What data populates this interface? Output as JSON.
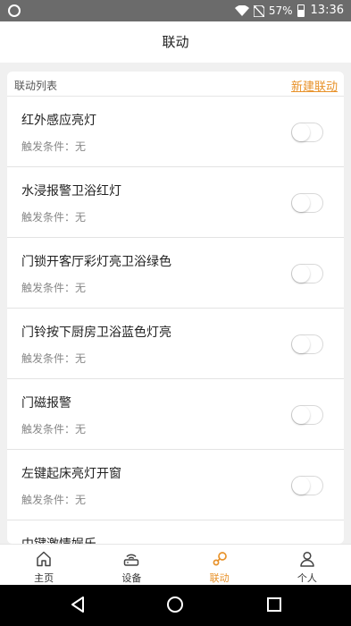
{
  "status_bar": {
    "battery": "57%",
    "time": "13:36"
  },
  "header": {
    "title": "联动"
  },
  "list": {
    "title": "联动列表",
    "new_link": "新建联动",
    "items": [
      {
        "name": "红外感应亮灯",
        "condition": "触发条件：无",
        "enabled": false
      },
      {
        "name": "水浸报警卫浴红灯",
        "condition": "触发条件：无",
        "enabled": false
      },
      {
        "name": "门锁开客厅彩灯亮卫浴绿色",
        "condition": "触发条件：无",
        "enabled": false
      },
      {
        "name": "门铃按下厨房卫浴蓝色灯亮",
        "condition": "触发条件：无",
        "enabled": false
      },
      {
        "name": "门磁报警",
        "condition": "触发条件：无",
        "enabled": false
      },
      {
        "name": "左键起床亮灯开窗",
        "condition": "触发条件：无",
        "enabled": false
      },
      {
        "name": "中键激情娱乐",
        "condition": "",
        "enabled": false
      }
    ]
  },
  "tabs": [
    {
      "label": "主页",
      "icon": "home-icon",
      "active": false
    },
    {
      "label": "设备",
      "icon": "router-icon",
      "active": false
    },
    {
      "label": "联动",
      "icon": "link-icon",
      "active": true
    },
    {
      "label": "个人",
      "icon": "person-icon",
      "active": false
    }
  ],
  "colors": {
    "accent": "#e8922a",
    "status_bar": "#6b6b6b"
  }
}
